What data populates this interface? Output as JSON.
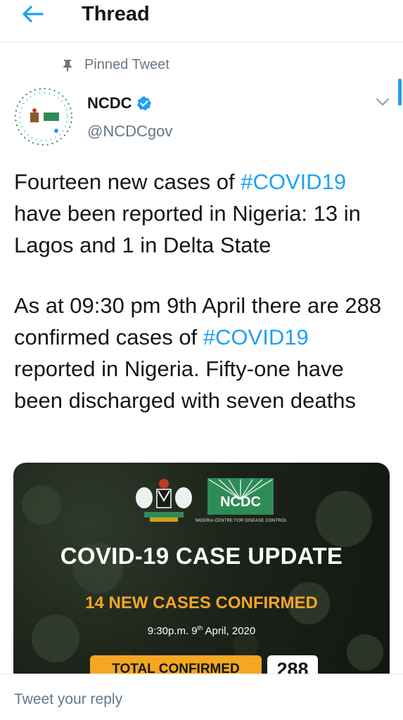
{
  "header": {
    "title": "Thread"
  },
  "pinned": {
    "label": "Pinned Tweet"
  },
  "tweet": {
    "author": {
      "name": "NCDC",
      "handle": "@NCDCgov"
    },
    "p1": {
      "a": "Fourteen new cases of ",
      "hashtag": "#COVID19",
      "b": " have been reported in Nigeria: 13 in Lagos and 1 in Delta State"
    },
    "p2": {
      "a": "As at 09:30 pm 9th April there are 288 confirmed cases of ",
      "hashtag": "#COVID19",
      "b": " reported in Nigeria. Fifty-one have been discharged with seven deaths"
    }
  },
  "media": {
    "logo_text": "NCDC",
    "logo_subtitle": "NIGERIA CENTRE FOR DISEASE CONTROL",
    "title": "COVID-19 CASE UPDATE",
    "subtitle": "14 NEW CASES CONFIRMED",
    "date_a": "9:30p.m. 9",
    "date_sup": "th",
    "date_b": " April, 2020",
    "total_label": "TOTAL CONFIRMED",
    "total_value": "288"
  },
  "reply": {
    "placeholder": "Tweet your reply"
  },
  "colors": {
    "accent": "#1da1f2",
    "text": "#14171a",
    "muted": "#657786",
    "highlight": "#f5a623",
    "card_bg": "#1c231a"
  },
  "icons": [
    "back-arrow-icon",
    "pin-icon",
    "verified-badge-icon",
    "chevron-down-icon",
    "coat-of-arms-icon",
    "ncdc-logo-icon"
  ]
}
